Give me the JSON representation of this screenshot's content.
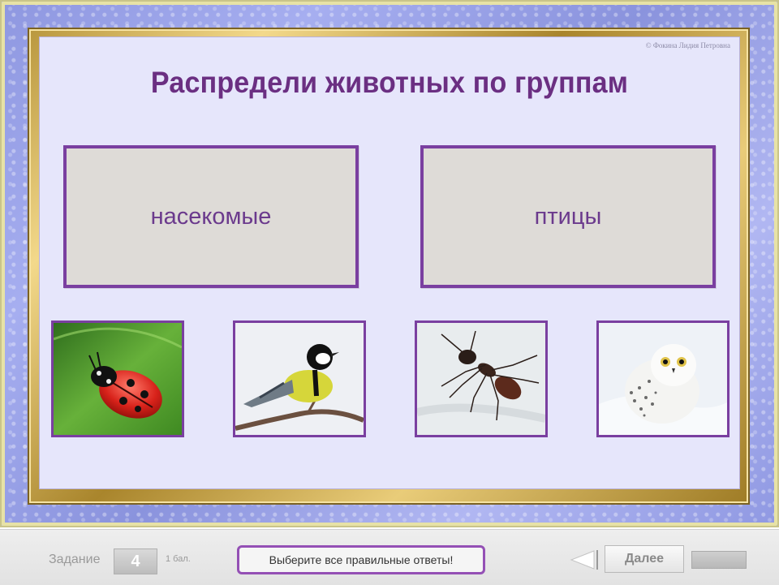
{
  "slide": {
    "copyright": "© Фокина Лидия Петровна",
    "title": "Распредели животных по группам",
    "groups": [
      {
        "label": "насекомые"
      },
      {
        "label": "птицы"
      }
    ],
    "cards": [
      {
        "animal": "ladybug",
        "icon": "ladybug-image"
      },
      {
        "animal": "great-tit",
        "icon": "bird-image"
      },
      {
        "animal": "ant",
        "icon": "ant-image"
      },
      {
        "animal": "snowy-owl",
        "icon": "owl-image"
      }
    ]
  },
  "toolbar": {
    "task_label": "Задание",
    "task_number": "4",
    "points": "1 бал.",
    "hint": "Выберите все правильные ответы!",
    "back_icon": "back-arrow-icon",
    "next_label": "Далее"
  },
  "colors": {
    "title": "#6b2f82",
    "border_accent": "#7a3fa0",
    "slide_bg": "#e6e6fb"
  }
}
